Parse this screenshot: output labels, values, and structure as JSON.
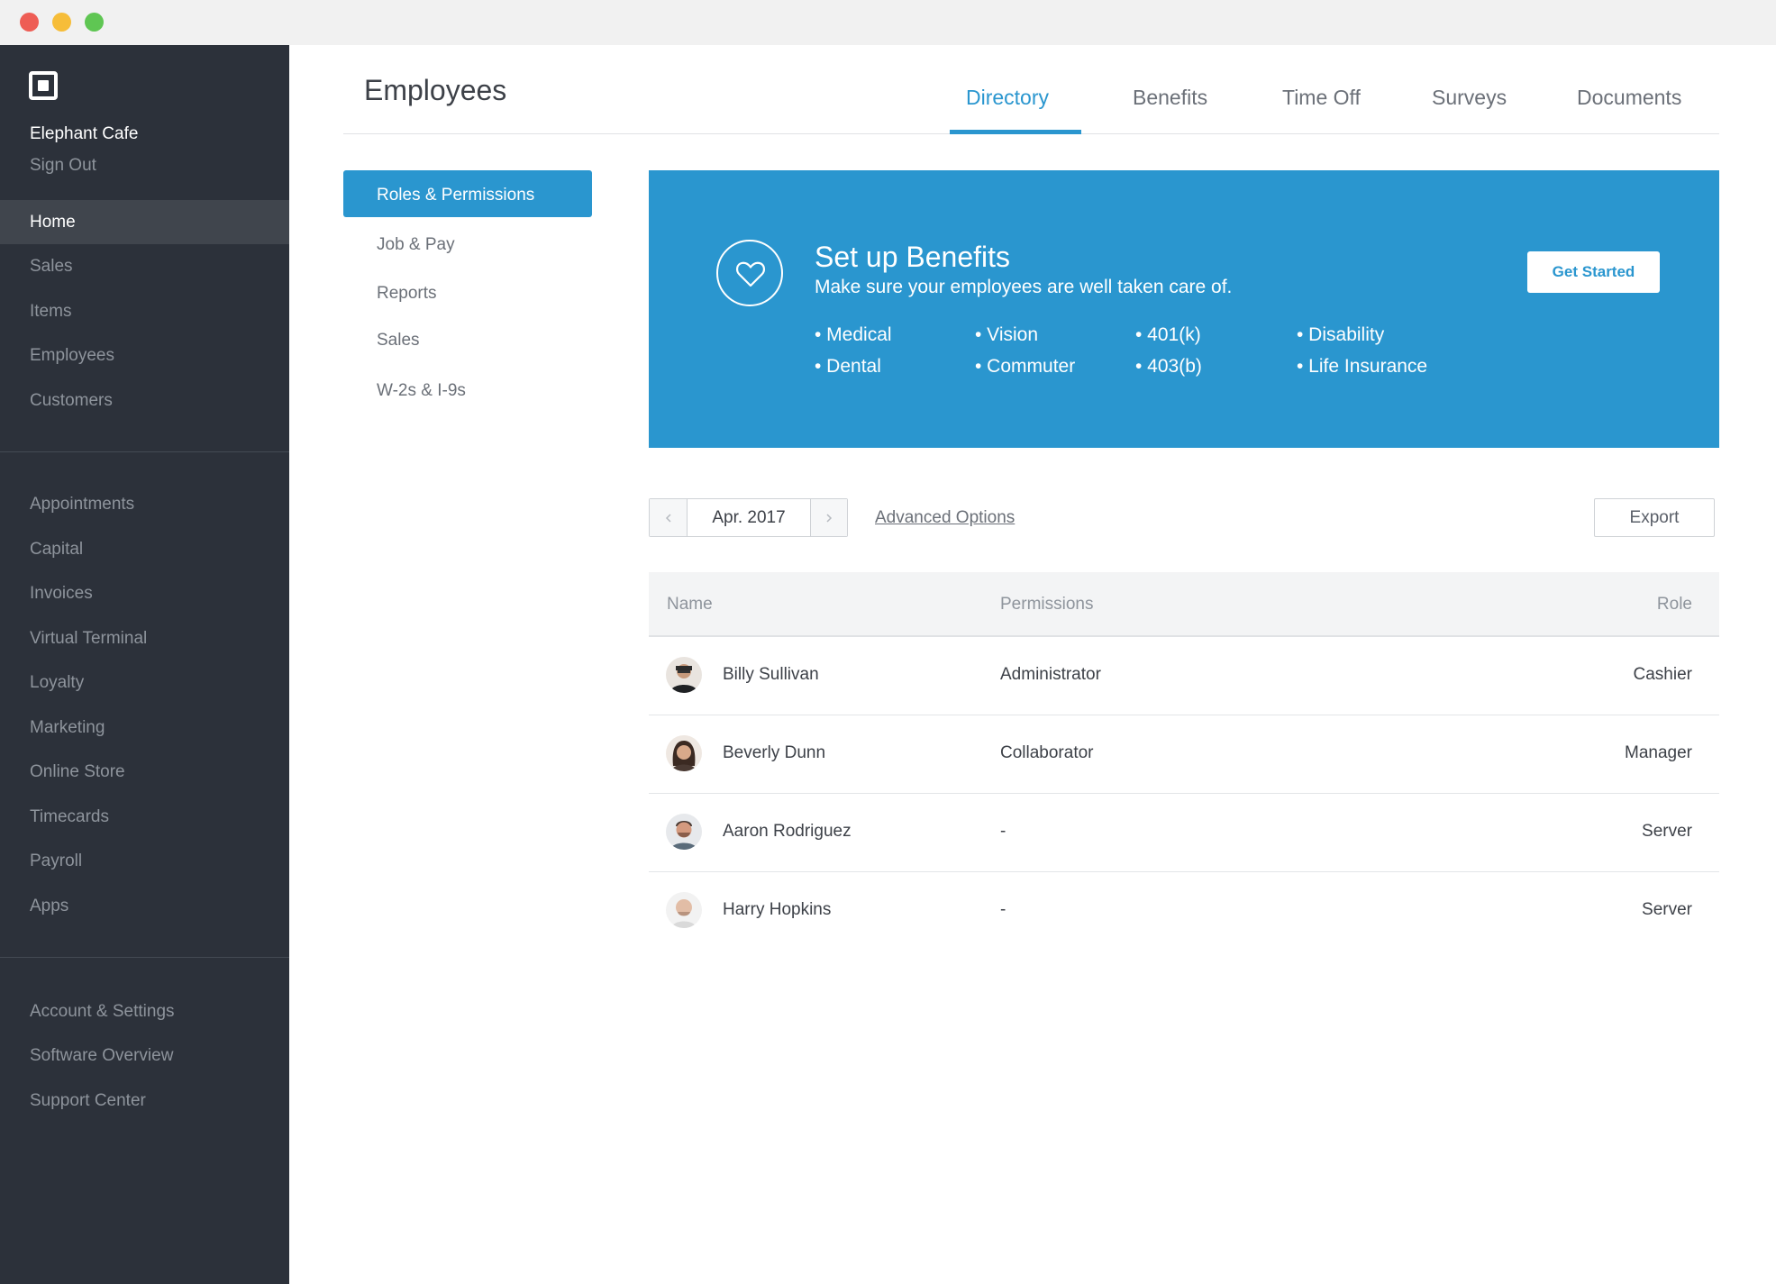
{
  "sidebar": {
    "business_name": "Elephant Cafe",
    "sign_out": "Sign Out",
    "primary_items": [
      {
        "label": "Home",
        "active": true
      },
      {
        "label": "Sales"
      },
      {
        "label": "Items"
      },
      {
        "label": "Employees"
      },
      {
        "label": "Customers"
      }
    ],
    "secondary_items": [
      {
        "label": "Appointments"
      },
      {
        "label": "Capital"
      },
      {
        "label": "Invoices"
      },
      {
        "label": "Virtual Terminal"
      },
      {
        "label": "Loyalty"
      },
      {
        "label": "Marketing"
      },
      {
        "label": "Online Store"
      },
      {
        "label": "Timecards"
      },
      {
        "label": "Payroll"
      },
      {
        "label": "Apps"
      }
    ],
    "footer_items": [
      {
        "label": "Account & Settings"
      },
      {
        "label": "Software Overview"
      },
      {
        "label": "Support Center"
      }
    ]
  },
  "header": {
    "title": "Employees",
    "tabs": [
      {
        "label": "Directory",
        "active": true
      },
      {
        "label": "Benefits"
      },
      {
        "label": "Time Off"
      },
      {
        "label": "Surveys"
      },
      {
        "label": "Documents"
      }
    ]
  },
  "submenu": {
    "items": [
      {
        "label": "Roles & Permissions",
        "active": true
      },
      {
        "label": "Job & Pay"
      },
      {
        "label": "Reports"
      },
      {
        "label": "Sales"
      },
      {
        "label": "W-2s & I-9s"
      }
    ]
  },
  "banner": {
    "icon": "heart-icon",
    "title": "Set up Benefits",
    "subtitle": "Make sure your employees are well taken care of.",
    "benefits": [
      [
        "• Medical",
        "• Dental"
      ],
      [
        "• Vision",
        "• Commuter"
      ],
      [
        "• 401(k)",
        "• 403(b)"
      ],
      [
        "• Disability",
        "• Life Insurance"
      ]
    ],
    "cta": "Get Started"
  },
  "controls": {
    "date": "Apr. 2017",
    "advanced_options": "Advanced Options",
    "export": "Export"
  },
  "table": {
    "columns": [
      "Name",
      "Permissions",
      "Role"
    ],
    "rows": [
      {
        "name": "Billy Sullivan",
        "permissions": "Administrator",
        "role": "Cashier"
      },
      {
        "name": "Beverly Dunn",
        "permissions": "Collaborator",
        "role": "Manager"
      },
      {
        "name": "Aaron Rodriguez",
        "permissions": "-",
        "role": "Server"
      },
      {
        "name": "Harry Hopkins",
        "permissions": "-",
        "role": "Server"
      }
    ]
  },
  "colors": {
    "accent": "#2a96cf",
    "sidebar_bg": "#2c313a",
    "sidebar_active": "#40454d"
  }
}
